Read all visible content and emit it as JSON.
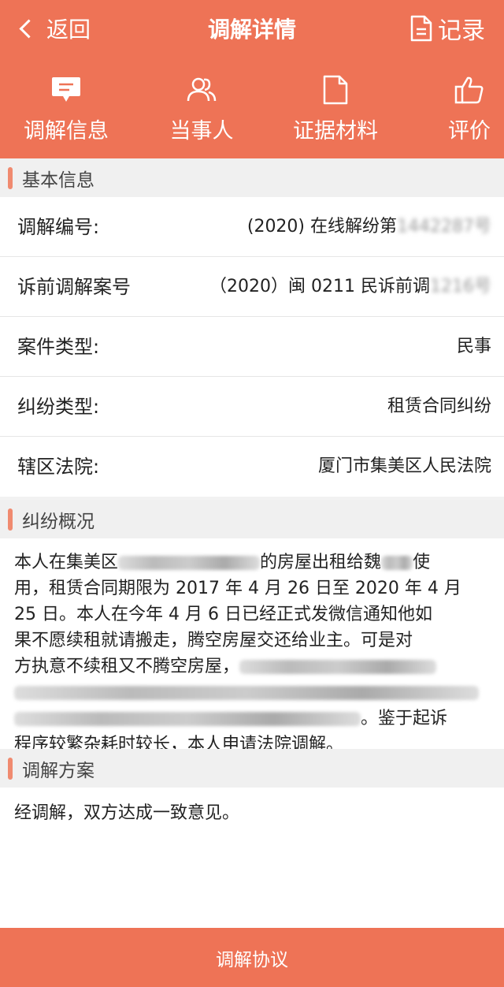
{
  "header": {
    "back_label": "返回",
    "title": "调解详情",
    "record_label": "记录"
  },
  "tabs": [
    {
      "label": "调解信息",
      "icon": "chat-bubble-icon"
    },
    {
      "label": "当事人",
      "icon": "people-icon"
    },
    {
      "label": "证据材料",
      "icon": "document-icon"
    },
    {
      "label": "评价",
      "icon": "thumbs-up-icon"
    }
  ],
  "basic_info": {
    "title": "基本信息",
    "rows": [
      {
        "label": "调解编号:",
        "value": "(2020) 在线解纷第",
        "value_blur": "1442287号"
      },
      {
        "label": "诉前调解案号",
        "value": "（2020）闽 0211 民诉前调",
        "value_blur": "1216号"
      },
      {
        "label": "案件类型:",
        "value": "民事",
        "value_blur": ""
      },
      {
        "label": "纠纷类型:",
        "value": "租赁合同纠纷",
        "value_blur": ""
      },
      {
        "label": "辖区法院:",
        "value": "厦门市集美区人民法院",
        "value_blur": ""
      }
    ]
  },
  "dispute": {
    "title": "纠纷概况",
    "line1_a": "本人在集美区",
    "line1_b": "的房屋出租给魏",
    "line1_c": "使",
    "line2": "用，租赁合同期限为 2017 年 4 月 26 日至 2020 年 4 月",
    "line3": "25 日。本人在今年 4 月 6 日已经正式发微信通知他如",
    "line4": "果不愿续租就请搬走，腾空房屋交还给业主。可是对",
    "line5": "方执意不续租又不腾空房屋，",
    "line7_end": "。鉴于起诉",
    "line8": "程序较繁杂耗时较长，本人申请法院调解。"
  },
  "plan": {
    "title": "调解方案",
    "text": "经调解，双方达成一致意见。"
  },
  "footer": {
    "button_label": "调解协议"
  },
  "colors": {
    "brand": "#ee7356",
    "accent_bar": "#f08a6f"
  }
}
